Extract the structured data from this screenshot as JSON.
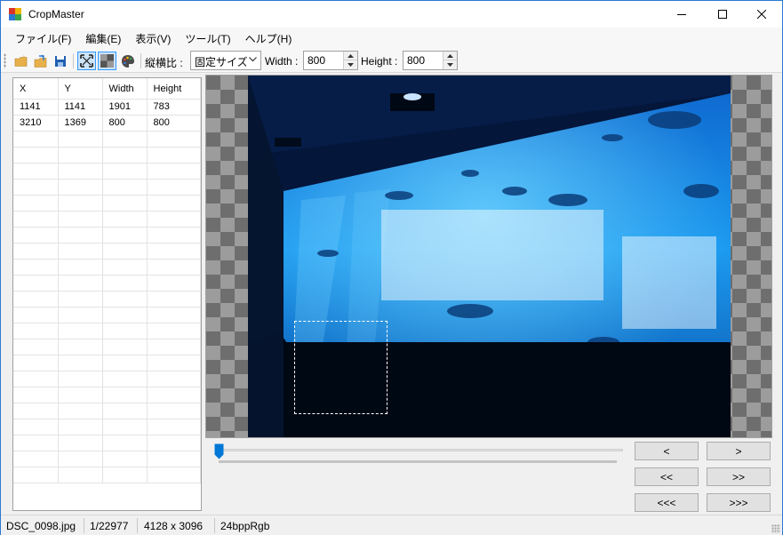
{
  "window": {
    "title": "CropMaster"
  },
  "menu": [
    {
      "label": "ファイル(F)"
    },
    {
      "label": "編集(E)"
    },
    {
      "label": "表示(V)"
    },
    {
      "label": "ツール(T)"
    },
    {
      "label": "ヘルプ(H)"
    }
  ],
  "toolbar": {
    "aspect_label": "縦横比 :",
    "aspect_value": "固定サイズ",
    "width_label": "Width :",
    "width_value": "800",
    "height_label": "Height :",
    "height_value": "800"
  },
  "grid": {
    "columns": [
      "X",
      "Y",
      "Width",
      "Height"
    ],
    "rows": [
      [
        "1141",
        "1141",
        "1901",
        "783"
      ],
      [
        "3210",
        "1369",
        "800",
        "800"
      ]
    ]
  },
  "navigation": {
    "prev": "<",
    "next": ">",
    "prev10": "<<",
    "next10": ">>",
    "prev100": "<<<",
    "next100": ">>>",
    "position_fraction": 0.0
  },
  "status": {
    "filename": "DSC_0098.jpg",
    "index": "1/22977",
    "dimensions": "4128 x 3096",
    "pixel_format": "24bppRgb"
  },
  "colors": {
    "accent": "#2b79d4",
    "selection": "#3399ff"
  }
}
